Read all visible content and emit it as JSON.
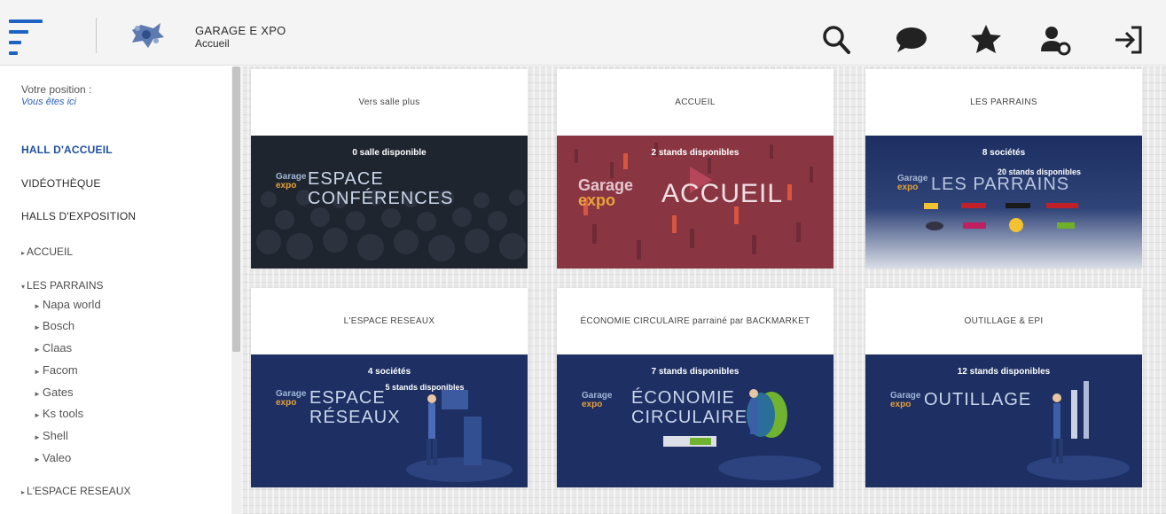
{
  "header": {
    "title": "GARAGE E XPO",
    "subtitle": "Accueil",
    "icons": [
      "search-icon",
      "chat-icon",
      "star-icon",
      "user-settings-icon",
      "logout-icon"
    ]
  },
  "sidebar": {
    "position_label": "Votre position :",
    "position_value": "Vous êtes ici",
    "main_items": [
      {
        "label": "HALL D'ACCUEIL"
      },
      {
        "label": "VIDÉOTHÈQUE"
      },
      {
        "label": "HALLS D'EXPOSITION"
      }
    ],
    "halls": [
      {
        "label": "ACCUEIL",
        "caret": "▸"
      },
      {
        "label": "LES PARRAINS",
        "caret": "▾"
      }
    ],
    "sponsors": [
      "Napa world",
      "Bosch",
      "Claas",
      "Facom",
      "Gates",
      "Ks tools",
      "Shell",
      "Valeo"
    ],
    "last_item": {
      "label": "L'ESPACE RESEAUX",
      "caret": "▸"
    }
  },
  "cards": [
    {
      "header": "Vers salle plus",
      "stands": "0 salle disponible",
      "big_text": [
        "ESPACE",
        "CONFÉRENCES"
      ],
      "logo": [
        "Garage",
        "expo"
      ]
    },
    {
      "header": "ACCUEIL",
      "stands": "2 stands disponibles",
      "big_text": [
        "ACCUEIL"
      ],
      "logo": [
        "Garage",
        "expo"
      ]
    },
    {
      "header": "LES PARRAINS",
      "stands": "8 sociétés",
      "stands2": "20 stands disponibles",
      "big_text": [
        "LES PARRAINS"
      ],
      "logo": [
        "Garage",
        "expo"
      ]
    },
    {
      "header": "L'ESPACE RESEAUX",
      "stands": "4 sociétés",
      "stands2": "5 stands disponibles",
      "big_text": [
        "ESPACE",
        "RÉSEAUX"
      ],
      "logo": [
        "Garage",
        "expo"
      ]
    },
    {
      "header": "ÉCONOMIE CIRCULAIRE parrainé par BACKMARKET",
      "stands": "7 stands disponibles",
      "big_text": [
        "ÉCONOMIE",
        "CIRCULAIRE"
      ],
      "logo": [
        "Garage",
        "expo"
      ]
    },
    {
      "header": "OUTILLAGE & EPI",
      "stands": "12 stands disponibles",
      "big_text": [
        "OUTILLAGE"
      ],
      "logo": [
        "Garage",
        "expo"
      ]
    }
  ],
  "colors": {
    "accent": "#1f63c2",
    "navy": "#1d2f63",
    "crimson": "#8a3642",
    "sidebar_active": "#1f4fa0"
  }
}
